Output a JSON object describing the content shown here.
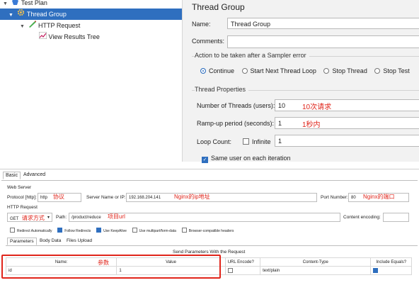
{
  "tree": {
    "items": [
      {
        "label": "Test Plan",
        "level": 0
      },
      {
        "label": "Thread Group",
        "level": 1,
        "selected": true
      },
      {
        "label": "HTTP Request",
        "level": 2
      },
      {
        "label": "View Results Tree",
        "level": 3
      }
    ]
  },
  "thread_group": {
    "title": "Thread Group",
    "name_label": "Name:",
    "name_value": "Thread Group",
    "comments_label": "Comments:",
    "action_legend": "Action to be taken after a Sampler error",
    "actions": [
      "Continue",
      "Start Next Thread Loop",
      "Stop Thread",
      "Stop Test"
    ],
    "selected_action": "Continue",
    "props_legend": "Thread Properties",
    "threads_label": "Number of Threads (users):",
    "threads_value": "10",
    "threads_anno": "10次请求",
    "rampup_label": "Ramp-up period (seconds):",
    "rampup_value": "1",
    "rampup_anno": "1秒内",
    "loop_label": "Loop Count:",
    "infinite_label": "Infinite",
    "loop_value": "1",
    "same_user_label": "Same user on each iteration"
  },
  "http": {
    "tabs": [
      "Basic",
      "Advanced"
    ],
    "web_server_legend": "Web Server",
    "protocol_label": "Protocol [http]:",
    "protocol_value": "http",
    "protocol_anno": "协议",
    "server_label": "Server Name or IP:",
    "server_value": "192.168.204.141",
    "server_anno": "Nginx的ip地址",
    "port_label": "Port Number:",
    "port_value": "80",
    "port_anno": "Nginx的端口",
    "http_request_legend": "HTTP Request",
    "method_value": "GET",
    "method_anno": "请求方式",
    "path_label": "Path:",
    "path_value": "/product/reduce",
    "path_anno": "项目url",
    "encoding_label": "Content encoding:",
    "checkboxes": [
      {
        "label": "Redirect Automatically",
        "checked": false
      },
      {
        "label": "Follow Redirects",
        "checked": true
      },
      {
        "label": "Use KeepAlive",
        "checked": true
      },
      {
        "label": "Use multipart/form-data",
        "checked": false
      },
      {
        "label": "Browser-compatible headers",
        "checked": false
      }
    ],
    "subtabs": [
      "Parameters",
      "Body Data",
      "Files Upload"
    ],
    "send_params_label": "Send Parameters With the Request",
    "columns": [
      "Name:",
      "Value",
      "URL Encode?",
      "Content-Type",
      "Include Equals?"
    ],
    "name_col_anno": "参数",
    "rows": [
      {
        "name": "id",
        "value": "1",
        "url_encode": false,
        "content_type": "text/plain",
        "include_equals": true
      }
    ]
  }
}
